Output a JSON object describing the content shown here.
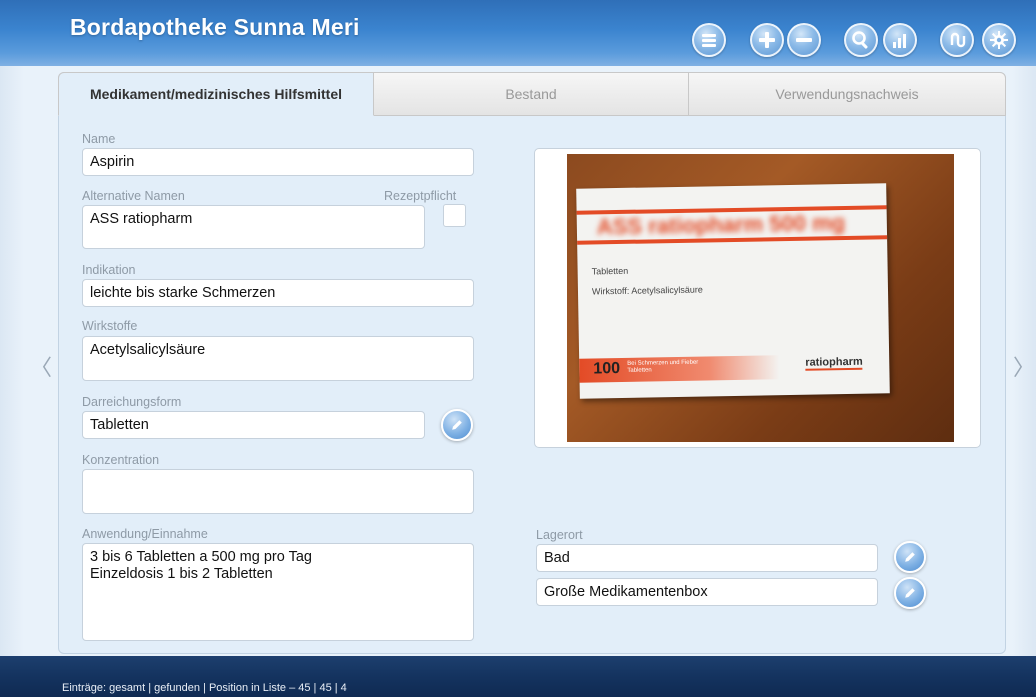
{
  "header": {
    "title": "Bordapotheke  Sunna Meri"
  },
  "toolbar": {
    "icons": [
      "list-icon",
      "plus-icon",
      "minus-icon",
      "search-icon",
      "chart-icon",
      "sync-icon",
      "gear-icon"
    ]
  },
  "tabs": [
    {
      "label": "Medikament/medizinisches Hilfsmittel",
      "active": true
    },
    {
      "label": "Bestand",
      "active": false
    },
    {
      "label": "Verwendungsnachweis",
      "active": false
    }
  ],
  "form": {
    "name": {
      "label": "Name",
      "value": "Aspirin"
    },
    "alternative_names": {
      "label": "Alternative Namen",
      "value": "ASS ratiopharm"
    },
    "prescription": {
      "label": "Rezeptpflicht",
      "checked": false
    },
    "indication": {
      "label": "Indikation",
      "value": "leichte bis starke Schmerzen"
    },
    "ingredients": {
      "label": "Wirkstoffe",
      "value": "Acetylsalicylsäure"
    },
    "dosage_form": {
      "label": "Darreichungsform",
      "value": "Tabletten"
    },
    "concentration": {
      "label": "Konzentration",
      "value": ""
    },
    "usage": {
      "label": "Anwendung/Einnahme",
      "value": "3 bis 6 Tabletten a 500 mg pro Tag\nEinzeldosis 1 bis 2 Tabletten"
    },
    "storage": {
      "label": "Lagerort",
      "value1": "Bad",
      "value2": "Große Medikamentenbox"
    }
  },
  "photo": {
    "brand": "ASS ratiopharm 500 mg",
    "line1": "Tabletten",
    "line2": "Wirkstoff: Acetylsalicylsäure",
    "count": "100",
    "small_text_1": "Bei Schmerzen und Fieber",
    "small_text_2": "Tabletten",
    "maker": "ratiopharm"
  },
  "footer": {
    "text": "Einträge: gesamt | gefunden | Position in Liste –  45 | 45 | 4"
  },
  "nav": {
    "prev": "〈",
    "next": "〉"
  },
  "colors": {
    "header": "#3b84cf",
    "footer": "#14335f",
    "accent": "#e34b26"
  }
}
